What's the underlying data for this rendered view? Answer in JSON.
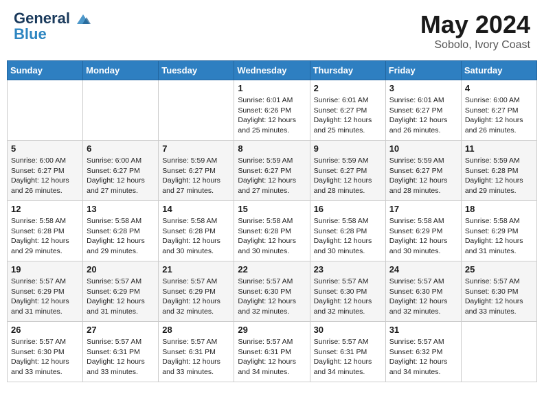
{
  "header": {
    "logo_line1": "General",
    "logo_line2": "Blue",
    "month_year": "May 2024",
    "location": "Sobolo, Ivory Coast"
  },
  "weekdays": [
    "Sunday",
    "Monday",
    "Tuesday",
    "Wednesday",
    "Thursday",
    "Friday",
    "Saturday"
  ],
  "weeks": [
    [
      {
        "day": "",
        "info": ""
      },
      {
        "day": "",
        "info": ""
      },
      {
        "day": "",
        "info": ""
      },
      {
        "day": "1",
        "info": "Sunrise: 6:01 AM\nSunset: 6:26 PM\nDaylight: 12 hours\nand 25 minutes."
      },
      {
        "day": "2",
        "info": "Sunrise: 6:01 AM\nSunset: 6:27 PM\nDaylight: 12 hours\nand 25 minutes."
      },
      {
        "day": "3",
        "info": "Sunrise: 6:01 AM\nSunset: 6:27 PM\nDaylight: 12 hours\nand 26 minutes."
      },
      {
        "day": "4",
        "info": "Sunrise: 6:00 AM\nSunset: 6:27 PM\nDaylight: 12 hours\nand 26 minutes."
      }
    ],
    [
      {
        "day": "5",
        "info": "Sunrise: 6:00 AM\nSunset: 6:27 PM\nDaylight: 12 hours\nand 26 minutes."
      },
      {
        "day": "6",
        "info": "Sunrise: 6:00 AM\nSunset: 6:27 PM\nDaylight: 12 hours\nand 27 minutes."
      },
      {
        "day": "7",
        "info": "Sunrise: 5:59 AM\nSunset: 6:27 PM\nDaylight: 12 hours\nand 27 minutes."
      },
      {
        "day": "8",
        "info": "Sunrise: 5:59 AM\nSunset: 6:27 PM\nDaylight: 12 hours\nand 27 minutes."
      },
      {
        "day": "9",
        "info": "Sunrise: 5:59 AM\nSunset: 6:27 PM\nDaylight: 12 hours\nand 28 minutes."
      },
      {
        "day": "10",
        "info": "Sunrise: 5:59 AM\nSunset: 6:27 PM\nDaylight: 12 hours\nand 28 minutes."
      },
      {
        "day": "11",
        "info": "Sunrise: 5:59 AM\nSunset: 6:28 PM\nDaylight: 12 hours\nand 29 minutes."
      }
    ],
    [
      {
        "day": "12",
        "info": "Sunrise: 5:58 AM\nSunset: 6:28 PM\nDaylight: 12 hours\nand 29 minutes."
      },
      {
        "day": "13",
        "info": "Sunrise: 5:58 AM\nSunset: 6:28 PM\nDaylight: 12 hours\nand 29 minutes."
      },
      {
        "day": "14",
        "info": "Sunrise: 5:58 AM\nSunset: 6:28 PM\nDaylight: 12 hours\nand 30 minutes."
      },
      {
        "day": "15",
        "info": "Sunrise: 5:58 AM\nSunset: 6:28 PM\nDaylight: 12 hours\nand 30 minutes."
      },
      {
        "day": "16",
        "info": "Sunrise: 5:58 AM\nSunset: 6:28 PM\nDaylight: 12 hours\nand 30 minutes."
      },
      {
        "day": "17",
        "info": "Sunrise: 5:58 AM\nSunset: 6:29 PM\nDaylight: 12 hours\nand 30 minutes."
      },
      {
        "day": "18",
        "info": "Sunrise: 5:58 AM\nSunset: 6:29 PM\nDaylight: 12 hours\nand 31 minutes."
      }
    ],
    [
      {
        "day": "19",
        "info": "Sunrise: 5:57 AM\nSunset: 6:29 PM\nDaylight: 12 hours\nand 31 minutes."
      },
      {
        "day": "20",
        "info": "Sunrise: 5:57 AM\nSunset: 6:29 PM\nDaylight: 12 hours\nand 31 minutes."
      },
      {
        "day": "21",
        "info": "Sunrise: 5:57 AM\nSunset: 6:29 PM\nDaylight: 12 hours\nand 32 minutes."
      },
      {
        "day": "22",
        "info": "Sunrise: 5:57 AM\nSunset: 6:30 PM\nDaylight: 12 hours\nand 32 minutes."
      },
      {
        "day": "23",
        "info": "Sunrise: 5:57 AM\nSunset: 6:30 PM\nDaylight: 12 hours\nand 32 minutes."
      },
      {
        "day": "24",
        "info": "Sunrise: 5:57 AM\nSunset: 6:30 PM\nDaylight: 12 hours\nand 32 minutes."
      },
      {
        "day": "25",
        "info": "Sunrise: 5:57 AM\nSunset: 6:30 PM\nDaylight: 12 hours\nand 33 minutes."
      }
    ],
    [
      {
        "day": "26",
        "info": "Sunrise: 5:57 AM\nSunset: 6:30 PM\nDaylight: 12 hours\nand 33 minutes."
      },
      {
        "day": "27",
        "info": "Sunrise: 5:57 AM\nSunset: 6:31 PM\nDaylight: 12 hours\nand 33 minutes."
      },
      {
        "day": "28",
        "info": "Sunrise: 5:57 AM\nSunset: 6:31 PM\nDaylight: 12 hours\nand 33 minutes."
      },
      {
        "day": "29",
        "info": "Sunrise: 5:57 AM\nSunset: 6:31 PM\nDaylight: 12 hours\nand 34 minutes."
      },
      {
        "day": "30",
        "info": "Sunrise: 5:57 AM\nSunset: 6:31 PM\nDaylight: 12 hours\nand 34 minutes."
      },
      {
        "day": "31",
        "info": "Sunrise: 5:57 AM\nSunset: 6:32 PM\nDaylight: 12 hours\nand 34 minutes."
      },
      {
        "day": "",
        "info": ""
      }
    ]
  ]
}
